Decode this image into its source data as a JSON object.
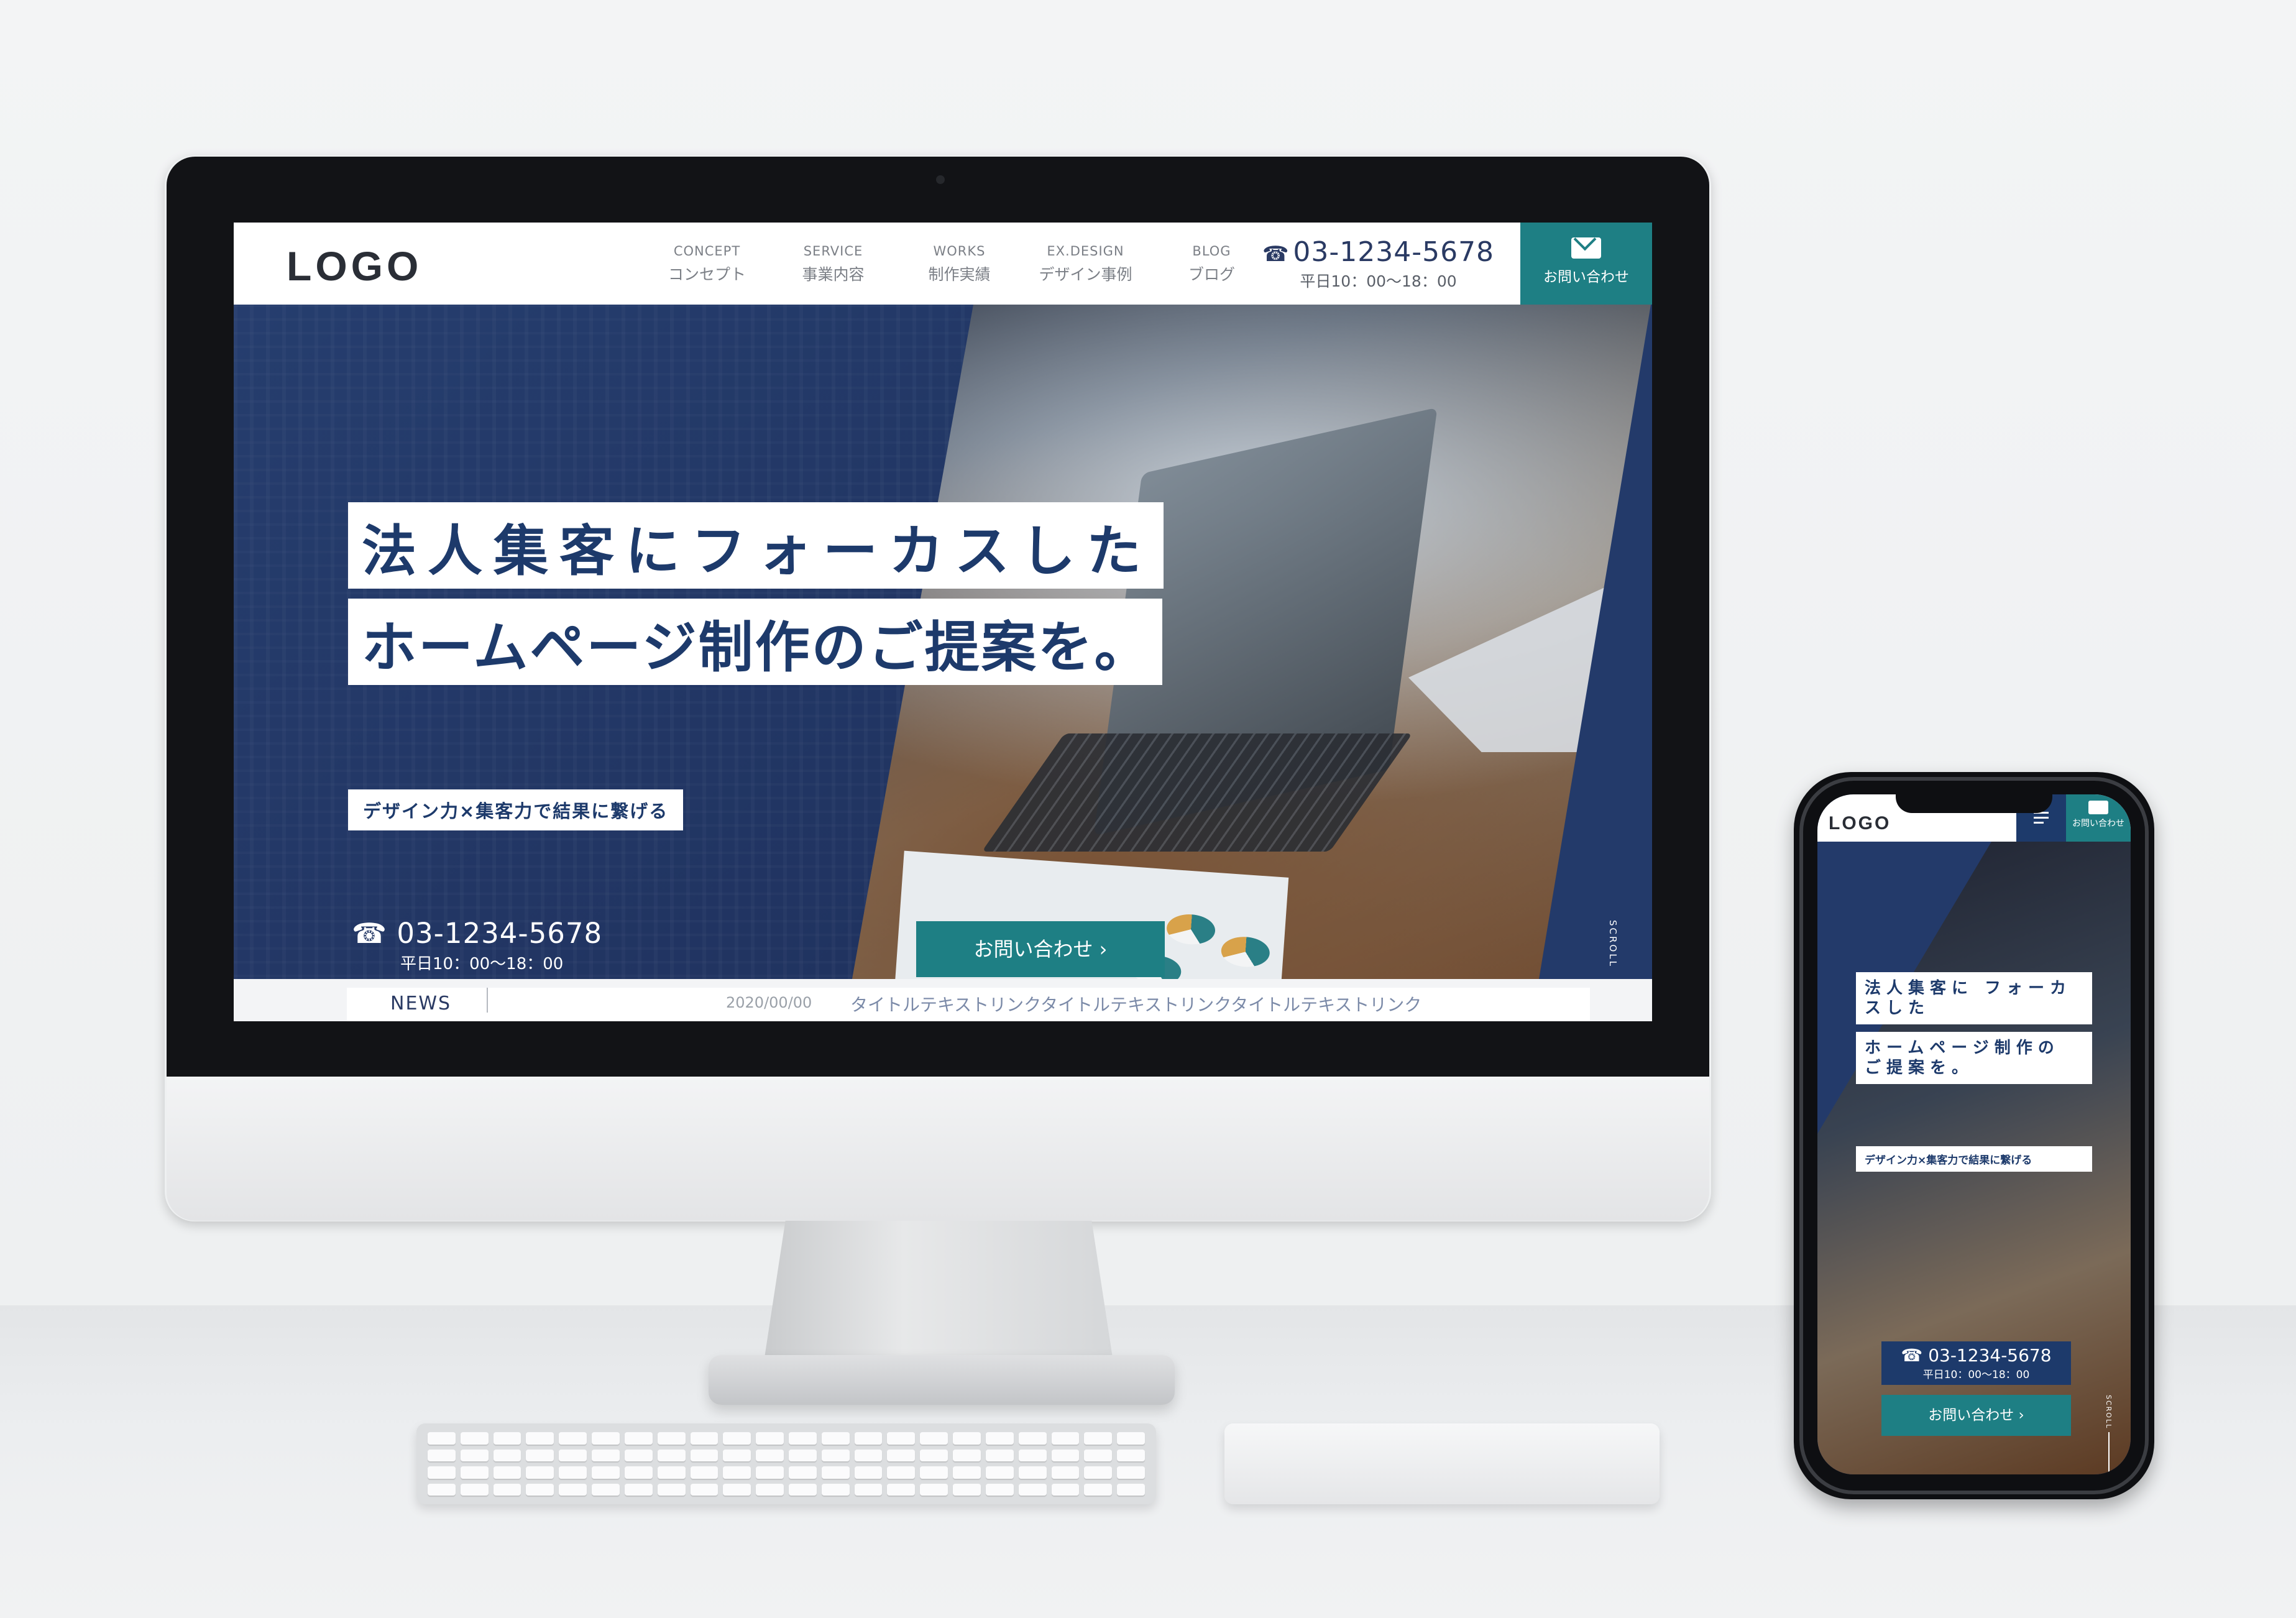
{
  "desktop": {
    "logo": "LOGO",
    "nav": [
      {
        "en": "CONCEPT",
        "ja": "コンセプト"
      },
      {
        "en": "SERVICE",
        "ja": "事業内容"
      },
      {
        "en": "WORKS",
        "ja": "制作実績"
      },
      {
        "en": "EX.DESIGN",
        "ja": "デザイン事例"
      },
      {
        "en": "BLOG",
        "ja": "ブログ"
      }
    ],
    "tel": {
      "number": "03-1234-5678",
      "hours": "平日10：00〜18：00"
    },
    "header_contact": "お問い合わせ",
    "hero": {
      "title_line1": "法人集客にフォーカスした",
      "title_line2": "ホームページ制作のご提案を。",
      "subtitle": "デザイン力×集客力で結果に繋げる",
      "tel_number": "03-1234-5678",
      "tel_hours": "平日10：00〜18：00",
      "cta": "お問い合わせ ›",
      "scroll": "SCROLL"
    },
    "news": {
      "label": "NEWS",
      "date": "2020/00/00",
      "title": "タイトルテキストリンクタイトルテキストリンクタイトルテキストリンク"
    }
  },
  "mobile": {
    "logo": "LOGO",
    "header_contact": "お問い合わせ",
    "title_line1": "法人集客に フォーカスした",
    "title_line2": "ホームページ制作の ご提案を。",
    "subtitle": "デザイン力×集客力で結果に繋げる",
    "tel_number": "03-1234-5678",
    "tel_hours": "平日10：00〜18：00",
    "cta": "お問い合わせ ›",
    "scroll": "SCROLL"
  },
  "colors": {
    "navy": "#1d3a6b",
    "teal": "#1e7f84",
    "hero_bg": "#233a6a"
  },
  "icons": [
    "phone-icon",
    "mail-icon",
    "hamburger-menu-icon",
    "chevron-right-icon"
  ]
}
